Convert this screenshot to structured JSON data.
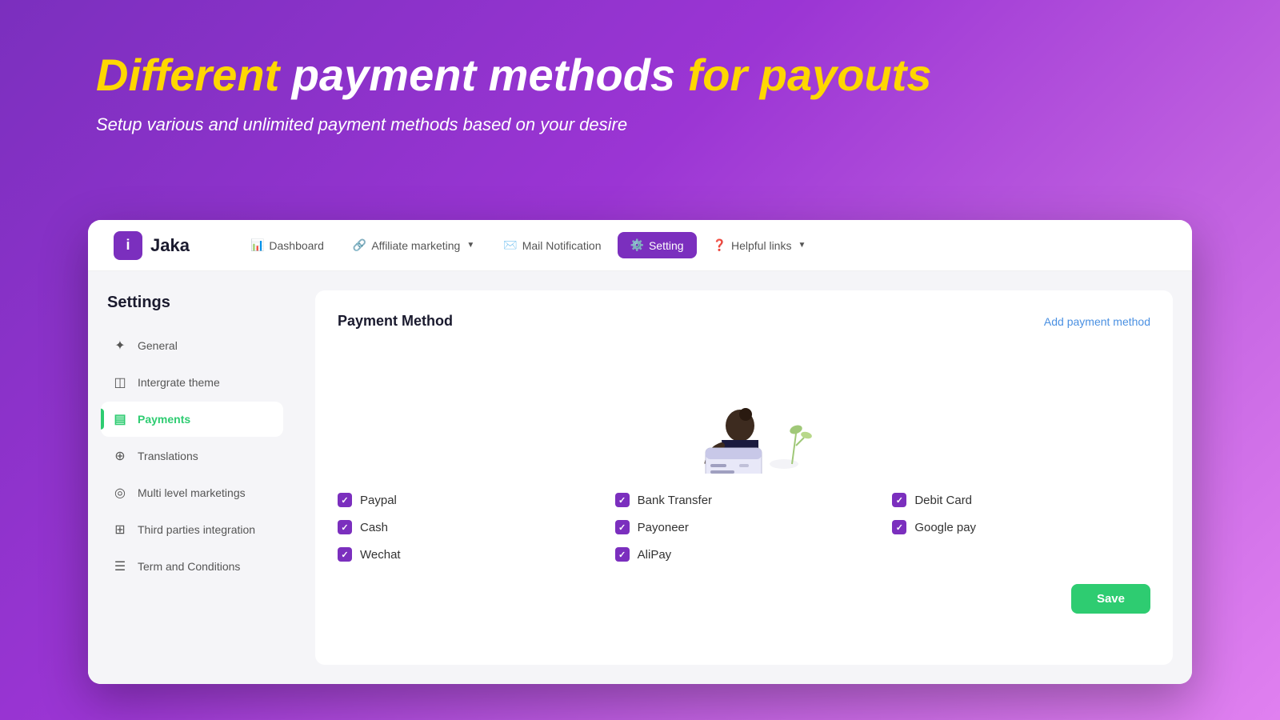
{
  "hero": {
    "title_part1": "Different",
    "title_part2": "payment methods",
    "title_part3": "for payouts",
    "subtitle": "Setup various and unlimited payment methods based on your desire"
  },
  "nav": {
    "logo_text": "Jaka",
    "logo_icon": "i",
    "items": [
      {
        "id": "dashboard",
        "label": "Dashboard",
        "icon": "📊",
        "active": false,
        "has_chevron": false
      },
      {
        "id": "affiliate",
        "label": "Affiliate marketing",
        "icon": "🔗",
        "active": false,
        "has_chevron": true
      },
      {
        "id": "mail",
        "label": "Mail Notification",
        "icon": "✉️",
        "active": false,
        "has_chevron": false
      },
      {
        "id": "setting",
        "label": "Setting",
        "icon": "⚙️",
        "active": true,
        "has_chevron": false
      },
      {
        "id": "helpful",
        "label": "Helpful links",
        "icon": "❓",
        "active": false,
        "has_chevron": true
      }
    ]
  },
  "sidebar": {
    "title": "Settings",
    "items": [
      {
        "id": "general",
        "label": "General",
        "icon": "✦",
        "active": false
      },
      {
        "id": "integrate-theme",
        "label": "Intergrate theme",
        "icon": "◫",
        "active": false
      },
      {
        "id": "payments",
        "label": "Payments",
        "icon": "▤",
        "active": true
      },
      {
        "id": "translations",
        "label": "Translations",
        "icon": "⊕",
        "active": false
      },
      {
        "id": "multi-level",
        "label": "Multi level marketings",
        "icon": "◎",
        "active": false
      },
      {
        "id": "third-parties",
        "label": "Third parties integration",
        "icon": "⊞",
        "active": false
      },
      {
        "id": "terms",
        "label": "Term and Conditions",
        "icon": "☰",
        "active": false
      }
    ]
  },
  "main": {
    "panel_title": "Payment Method",
    "add_link": "Add payment method",
    "payments": [
      {
        "id": "paypal",
        "label": "Paypal",
        "checked": true
      },
      {
        "id": "bank-transfer",
        "label": "Bank Transfer",
        "checked": true
      },
      {
        "id": "debit-card",
        "label": "Debit Card",
        "checked": true
      },
      {
        "id": "cash",
        "label": "Cash",
        "checked": true
      },
      {
        "id": "payoneer",
        "label": "Payoneer",
        "checked": true
      },
      {
        "id": "google-pay",
        "label": "Google pay",
        "checked": true
      },
      {
        "id": "wechat",
        "label": "Wechat",
        "checked": true
      },
      {
        "id": "alipay",
        "label": "AliPay",
        "checked": true
      }
    ],
    "save_button": "Save"
  }
}
